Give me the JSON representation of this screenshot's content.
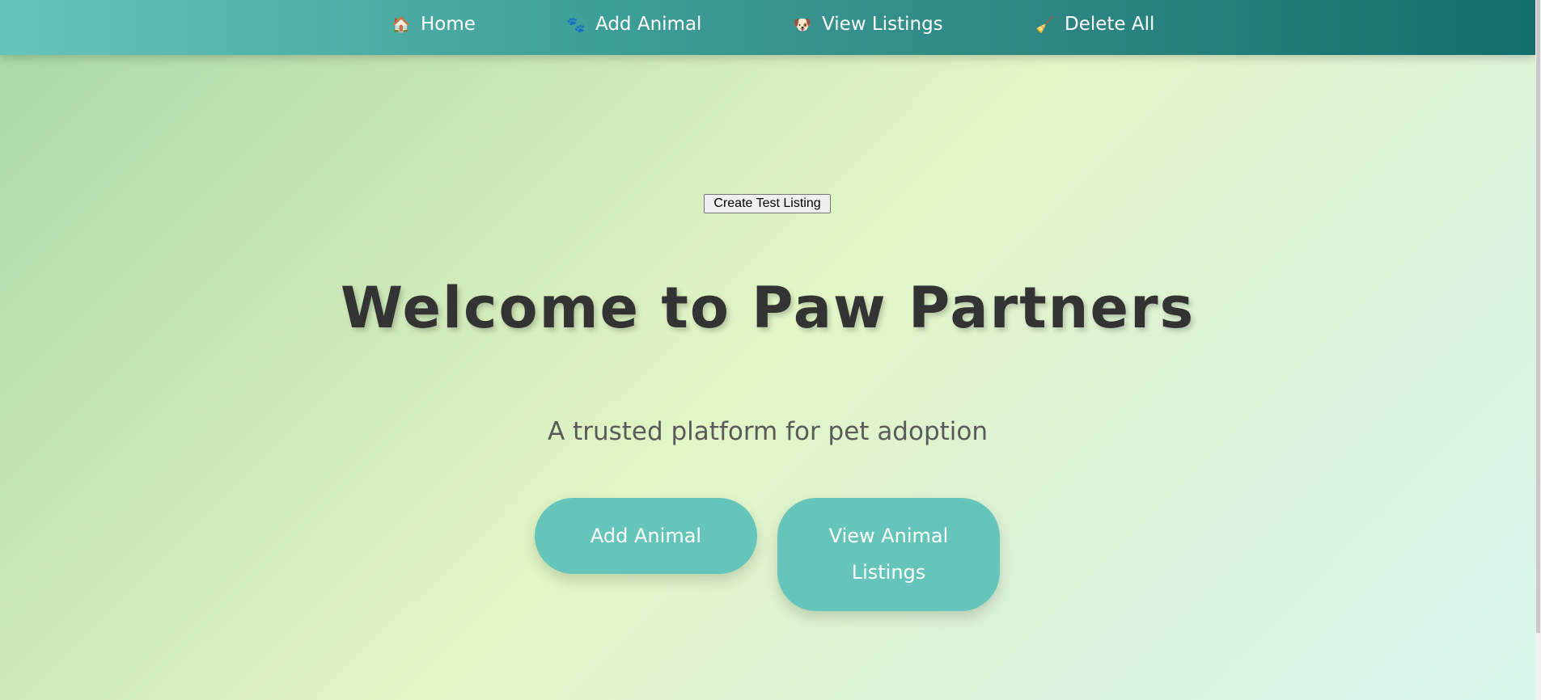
{
  "nav": {
    "items": [
      {
        "icon": "house-icon",
        "glyph": "🏠",
        "label": "Home"
      },
      {
        "icon": "paw-icon",
        "glyph": "🐾",
        "label": "Add Animal"
      },
      {
        "icon": "dog-face-icon",
        "glyph": "🐶",
        "label": "View Listings"
      },
      {
        "icon": "broom-icon",
        "glyph": "🧹",
        "label": "Delete All"
      }
    ],
    "colors": {
      "start": "#66c5bb",
      "end": "#126f6b"
    }
  },
  "test_button": {
    "label": "Create Test Listing"
  },
  "hero": {
    "title": "Welcome to Paw Partners",
    "subtitle": "A trusted platform for pet adoption"
  },
  "actions": {
    "add_label": "Add Animal",
    "view_label": "View Animal Listings"
  },
  "colors": {
    "accent": "#66c5bb",
    "title_text": "#333333",
    "subtitle_text": "#5a5a5a"
  }
}
